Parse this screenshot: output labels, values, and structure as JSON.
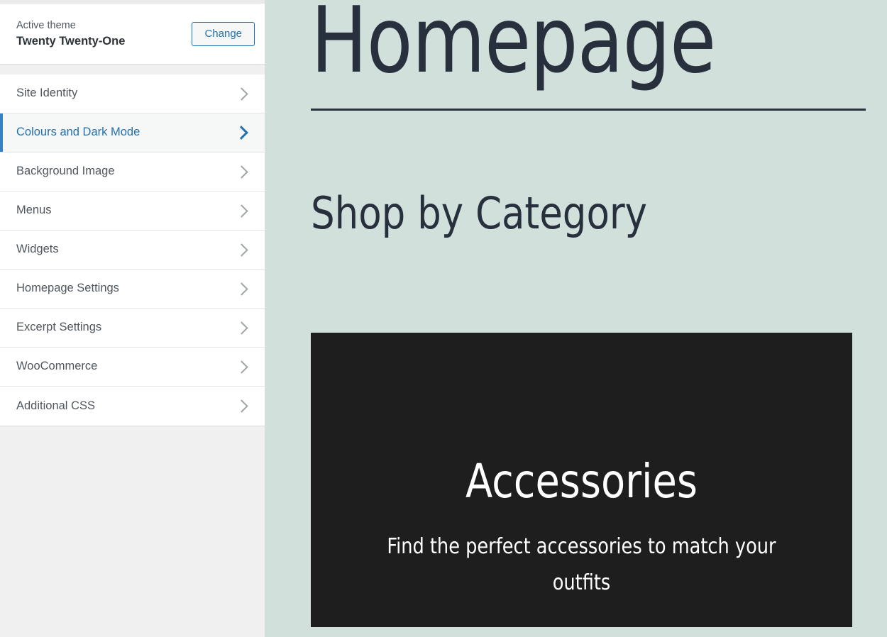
{
  "sidebar": {
    "theme": {
      "label": "Active theme",
      "name": "Twenty Twenty-One",
      "change_label": "Change"
    },
    "sections": [
      {
        "label": "Site Identity",
        "icon": "chevron-right-icon",
        "active": false
      },
      {
        "label": "Colours and Dark Mode",
        "icon": "chevron-right-icon",
        "active": true
      },
      {
        "label": "Background Image",
        "icon": "chevron-right-icon",
        "active": false
      },
      {
        "label": "Menus",
        "icon": "chevron-right-icon",
        "active": false
      },
      {
        "label": "Widgets",
        "icon": "chevron-right-icon",
        "active": false
      },
      {
        "label": "Homepage Settings",
        "icon": "chevron-right-icon",
        "active": false
      },
      {
        "label": "Excerpt Settings",
        "icon": "chevron-right-icon",
        "active": false
      },
      {
        "label": "WooCommerce",
        "icon": "chevron-right-icon",
        "active": false
      },
      {
        "label": "Additional CSS",
        "icon": "chevron-right-icon",
        "active": false
      }
    ]
  },
  "preview": {
    "site_title": "Homepage",
    "section_heading": "Shop by Category",
    "category_card": {
      "title": "Accessories",
      "description": "Find the perfect accessories to match your outfits"
    }
  },
  "colors": {
    "accent_blue": "#2271b1",
    "active_border_blue": "#3582c4",
    "preview_background": "#d1e0db",
    "preview_text": "#28303d",
    "card_background": "#1e1e1e",
    "card_text": "#ffffff",
    "sidebar_background": "#f0f0f0",
    "list_background": "#ffffff",
    "active_row_background": "#f6f7f7",
    "chevron_gray": "#a0a5aa"
  }
}
